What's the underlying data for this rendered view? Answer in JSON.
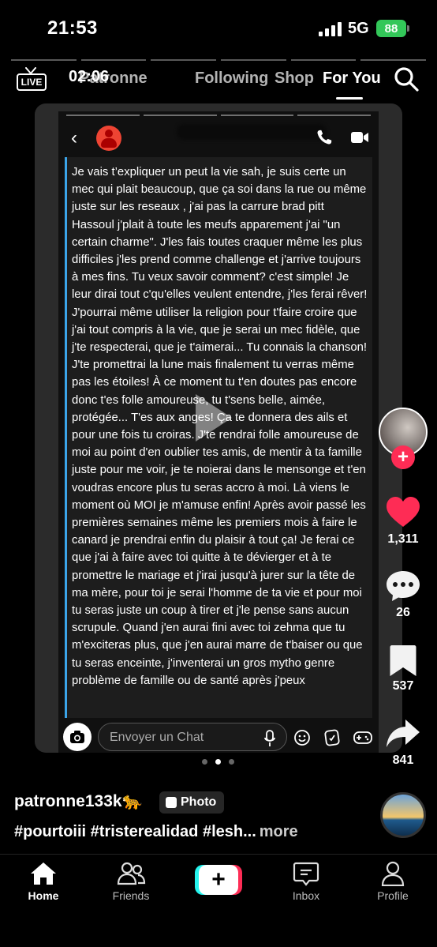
{
  "status_bar": {
    "time": "21:53",
    "network": "5G",
    "battery": "88"
  },
  "top_nav": {
    "live_label": "LIVE",
    "tabs": [
      "Patronne",
      "Following",
      "Shop",
      "For You"
    ],
    "overlay_time": "02:06",
    "overlay_network": "5G"
  },
  "post": {
    "chat_placeholder": "Envoyer un Chat",
    "message": "Je vais t’expliquer un peut la vie sah, je suis certe un mec qui plait beaucoup, que ça soi dans la rue ou même juste sur les reseaux , j'ai pas la carrure brad pitt  Hassoul j'plait à toute les meufs apparement j'ai \"un certain charme\". J'les fais toutes craquer même les plus difficiles j'les prend comme challenge et j'arrive toujours à mes fins. Tu veux savoir comment? c'est simple! Je leur dirai tout c'qu'elles veulent entendre, j'les ferai rêver! J'pourrai même utiliser la religion pour t'faire croire que j'ai tout compris à la vie, que je serai un mec fidèle, que j'te respecterai, que je t'aimerai... Tu connais la chanson! J'te promettrai la lune mais finalement tu verras même pas les étoiles! À ce moment tu t'en doutes pas encore donc t'es folle amoureuse, tu t'sens belle, aimée, protégée... T'es aux anges! Ça te donnera des ails et pour une fois tu croiras. J'te rendrai folle amoureuse de moi au point d'en oublier tes amis, de mentir à ta famille juste pour me voir, je te noierai dans le mensonge et t'en voudras encore plus tu seras accro à moi. Là viens le moment où MOI je m'amuse enfin! Après avoir passé les premières semaines même les premiers mois à faire le canard je prendrai enfin du plaisir à tout ça! Je ferai ce que j'ai à faire avec toi quitte à te dévierger et à te promettre le mariage et j'irai jusqu'à jurer sur la tête de ma mère, pour toi je serai l'homme de ta vie et pour moi tu seras juste un coup à tirer et j'le pense sans aucun scrupule. Quand j'en aurai fini avec toi zehma que tu m'exciteras plus, que j'en aurai marre de t'baiser ou que tu seras enceinte, j'inventerai un gros mytho genre problème de famille ou de santé après j'peux"
  },
  "actions": {
    "likes": "1,311",
    "comments": "26",
    "saves": "537",
    "shares": "841"
  },
  "caption": {
    "username": "patronne133k🐆",
    "type_badge": "Photo",
    "hashtags": "#pourtoiii #tristerealidad #lesh...",
    "more": "more"
  },
  "bottom_nav": {
    "items": [
      {
        "label": "Home"
      },
      {
        "label": "Friends"
      },
      {
        "label": "Inbox"
      },
      {
        "label": "Profile"
      }
    ],
    "create": "+"
  },
  "colors": {
    "like": "#fe2c55",
    "accent_cyan": "#25f4ee",
    "battery": "#33c759",
    "quote_bar": "#3ba4e8"
  }
}
